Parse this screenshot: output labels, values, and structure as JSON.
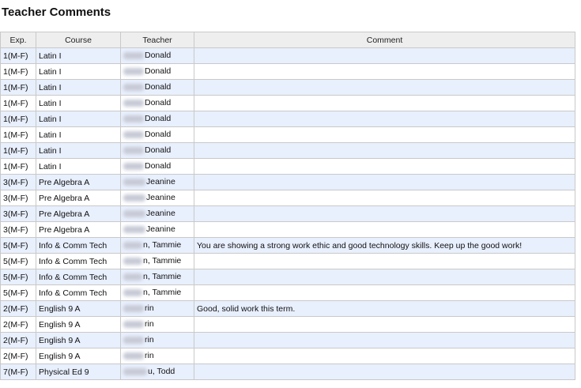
{
  "page_title": "Teacher Comments",
  "table": {
    "headers": [
      "Exp.",
      "Course",
      "Teacher",
      "Comment"
    ],
    "rows": [
      {
        "exp": "1(M-F)",
        "course": "Latin I",
        "teacher": "Donald",
        "comment": ""
      },
      {
        "exp": "1(M-F)",
        "course": "Latin I",
        "teacher": "Donald",
        "comment": ""
      },
      {
        "exp": "1(M-F)",
        "course": "Latin I",
        "teacher": "Donald",
        "comment": ""
      },
      {
        "exp": "1(M-F)",
        "course": "Latin I",
        "teacher": "Donald",
        "comment": ""
      },
      {
        "exp": "1(M-F)",
        "course": "Latin I",
        "teacher": "Donald",
        "comment": ""
      },
      {
        "exp": "1(M-F)",
        "course": "Latin I",
        "teacher": "Donald",
        "comment": ""
      },
      {
        "exp": "1(M-F)",
        "course": "Latin I",
        "teacher": "Donald",
        "comment": ""
      },
      {
        "exp": "1(M-F)",
        "course": "Latin I",
        "teacher": "Donald",
        "comment": ""
      },
      {
        "exp": "3(M-F)",
        "course": "Pre Algebra A",
        "teacher": "Jeanine",
        "comment": ""
      },
      {
        "exp": "3(M-F)",
        "course": "Pre Algebra A",
        "teacher": "Jeanine",
        "comment": ""
      },
      {
        "exp": "3(M-F)",
        "course": "Pre Algebra A",
        "teacher": "Jeanine",
        "comment": ""
      },
      {
        "exp": "3(M-F)",
        "course": "Pre Algebra A",
        "teacher": "Jeanine",
        "comment": ""
      },
      {
        "exp": "5(M-F)",
        "course": "Info & Comm Tech",
        "teacher": "n, Tammie",
        "comment": "You are showing a strong work ethic and good technology skills. Keep up the good work!"
      },
      {
        "exp": "5(M-F)",
        "course": "Info & Comm Tech",
        "teacher": "n, Tammie",
        "comment": ""
      },
      {
        "exp": "5(M-F)",
        "course": "Info & Comm Tech",
        "teacher": "n, Tammie",
        "comment": ""
      },
      {
        "exp": "5(M-F)",
        "course": "Info & Comm Tech",
        "teacher": "n, Tammie",
        "comment": ""
      },
      {
        "exp": "2(M-F)",
        "course": "English 9 A",
        "teacher": "rin",
        "comment": "Good, solid work this term."
      },
      {
        "exp": "2(M-F)",
        "course": "English 9 A",
        "teacher": "rin",
        "comment": ""
      },
      {
        "exp": "2(M-F)",
        "course": "English 9 A",
        "teacher": "rin",
        "comment": ""
      },
      {
        "exp": "2(M-F)",
        "course": "English 9 A",
        "teacher": "rin",
        "comment": ""
      },
      {
        "exp": "7(M-F)",
        "course": "Physical Ed 9",
        "teacher": "u, Todd",
        "comment": ""
      }
    ]
  },
  "colors": {
    "row_alt": "#e8effd",
    "row_plain": "#ffffff",
    "header_bg": "#eeeeee",
    "border": "#c9c9c9"
  }
}
